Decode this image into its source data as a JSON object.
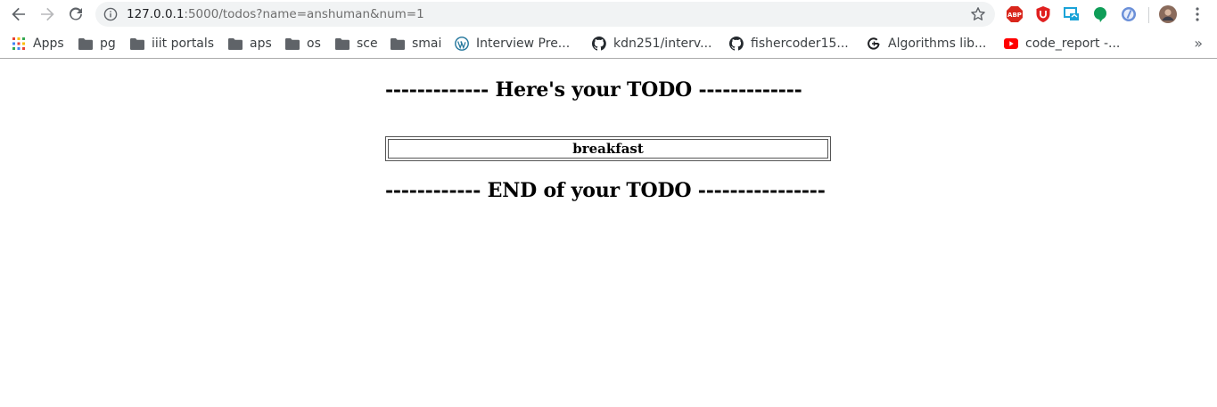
{
  "browser": {
    "url_host": "127.0.0.1",
    "url_rest": ":5000/todos?name=anshuman&num=1",
    "extensions": [
      {
        "name": "adblock-plus-icon",
        "text": "ABP",
        "color": "#d9261c"
      },
      {
        "name": "ublock-icon",
        "color": "#e02020"
      },
      {
        "name": "screen-share-icon",
        "color": "#1aa3d8"
      },
      {
        "name": "chat-bubble-icon",
        "color": "#0f9d58"
      },
      {
        "name": "extension-blue-icon",
        "color": "#6a8fd8"
      }
    ]
  },
  "bookmarks": {
    "items": [
      {
        "label": "Apps",
        "icon": "apps-grid-icon"
      },
      {
        "label": "pg",
        "icon": "folder-icon"
      },
      {
        "label": "iiit portals",
        "icon": "folder-icon"
      },
      {
        "label": "aps",
        "icon": "folder-icon"
      },
      {
        "label": "os",
        "icon": "folder-icon"
      },
      {
        "label": "sce",
        "icon": "folder-icon"
      },
      {
        "label": "smai",
        "icon": "folder-icon"
      },
      {
        "label": "Interview Pre...",
        "icon": "wordpress-icon"
      },
      {
        "label": "kdn251/interv...",
        "icon": "github-icon"
      },
      {
        "label": "fishercoder15...",
        "icon": "github-icon"
      },
      {
        "label": "Algorithms lib...",
        "icon": "g-plus-icon"
      },
      {
        "label": "code_report -...",
        "icon": "youtube-icon"
      }
    ],
    "more": "»"
  },
  "page": {
    "heading_top": "------------- Here's your TODO -------------",
    "todos": [
      "breakfast"
    ],
    "heading_bottom": "------------ END of your TODO ----------------"
  }
}
